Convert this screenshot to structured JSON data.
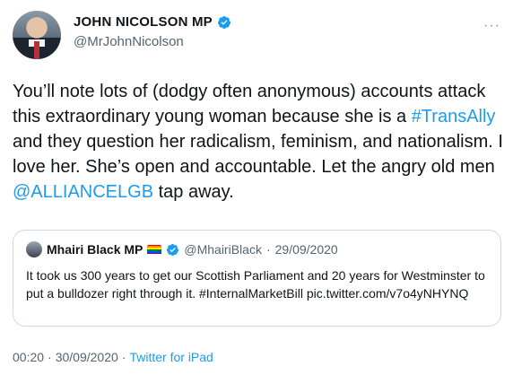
{
  "author": {
    "display_name": "JOHN NICOLSON MP",
    "handle": "@MrJohnNicolson"
  },
  "more_menu": "···",
  "tweet": {
    "text_1": "You’ll note lots of (dodgy often anonymous) accounts attack this extraordinary young woman because she is a ",
    "hashtag_1": "#TransAlly",
    "text_2": " and they question her radicalism, feminism, and nationalism. I love her. She’s open and accountable. Let the angry old men ",
    "mention_1": "@ALLIANCELGB",
    "text_3": " tap away."
  },
  "quote": {
    "name": "Mhairi Black MP",
    "handle": "@MhairiBlack",
    "separator": "·",
    "date": "29/09/2020",
    "text": "It took us 300 years to get our Scottish Parliament and 20 years for Westminster to put a bulldozer right through it. #InternalMarketBill pic.twitter.com/v7o4yNHYNQ"
  },
  "footer": {
    "time": "00:20",
    "sep1": "·",
    "date": "30/09/2020",
    "sep2": "·",
    "source": "Twitter for iPad"
  },
  "colors": {
    "link": "#1d9bf0",
    "secondary_text": "#536471",
    "verified_badge": "#1d9bf0"
  },
  "icons": {
    "verified": "verified-badge-icon",
    "more": "more-dots-icon",
    "rainbow_flag": "rainbow-flag-icon"
  }
}
